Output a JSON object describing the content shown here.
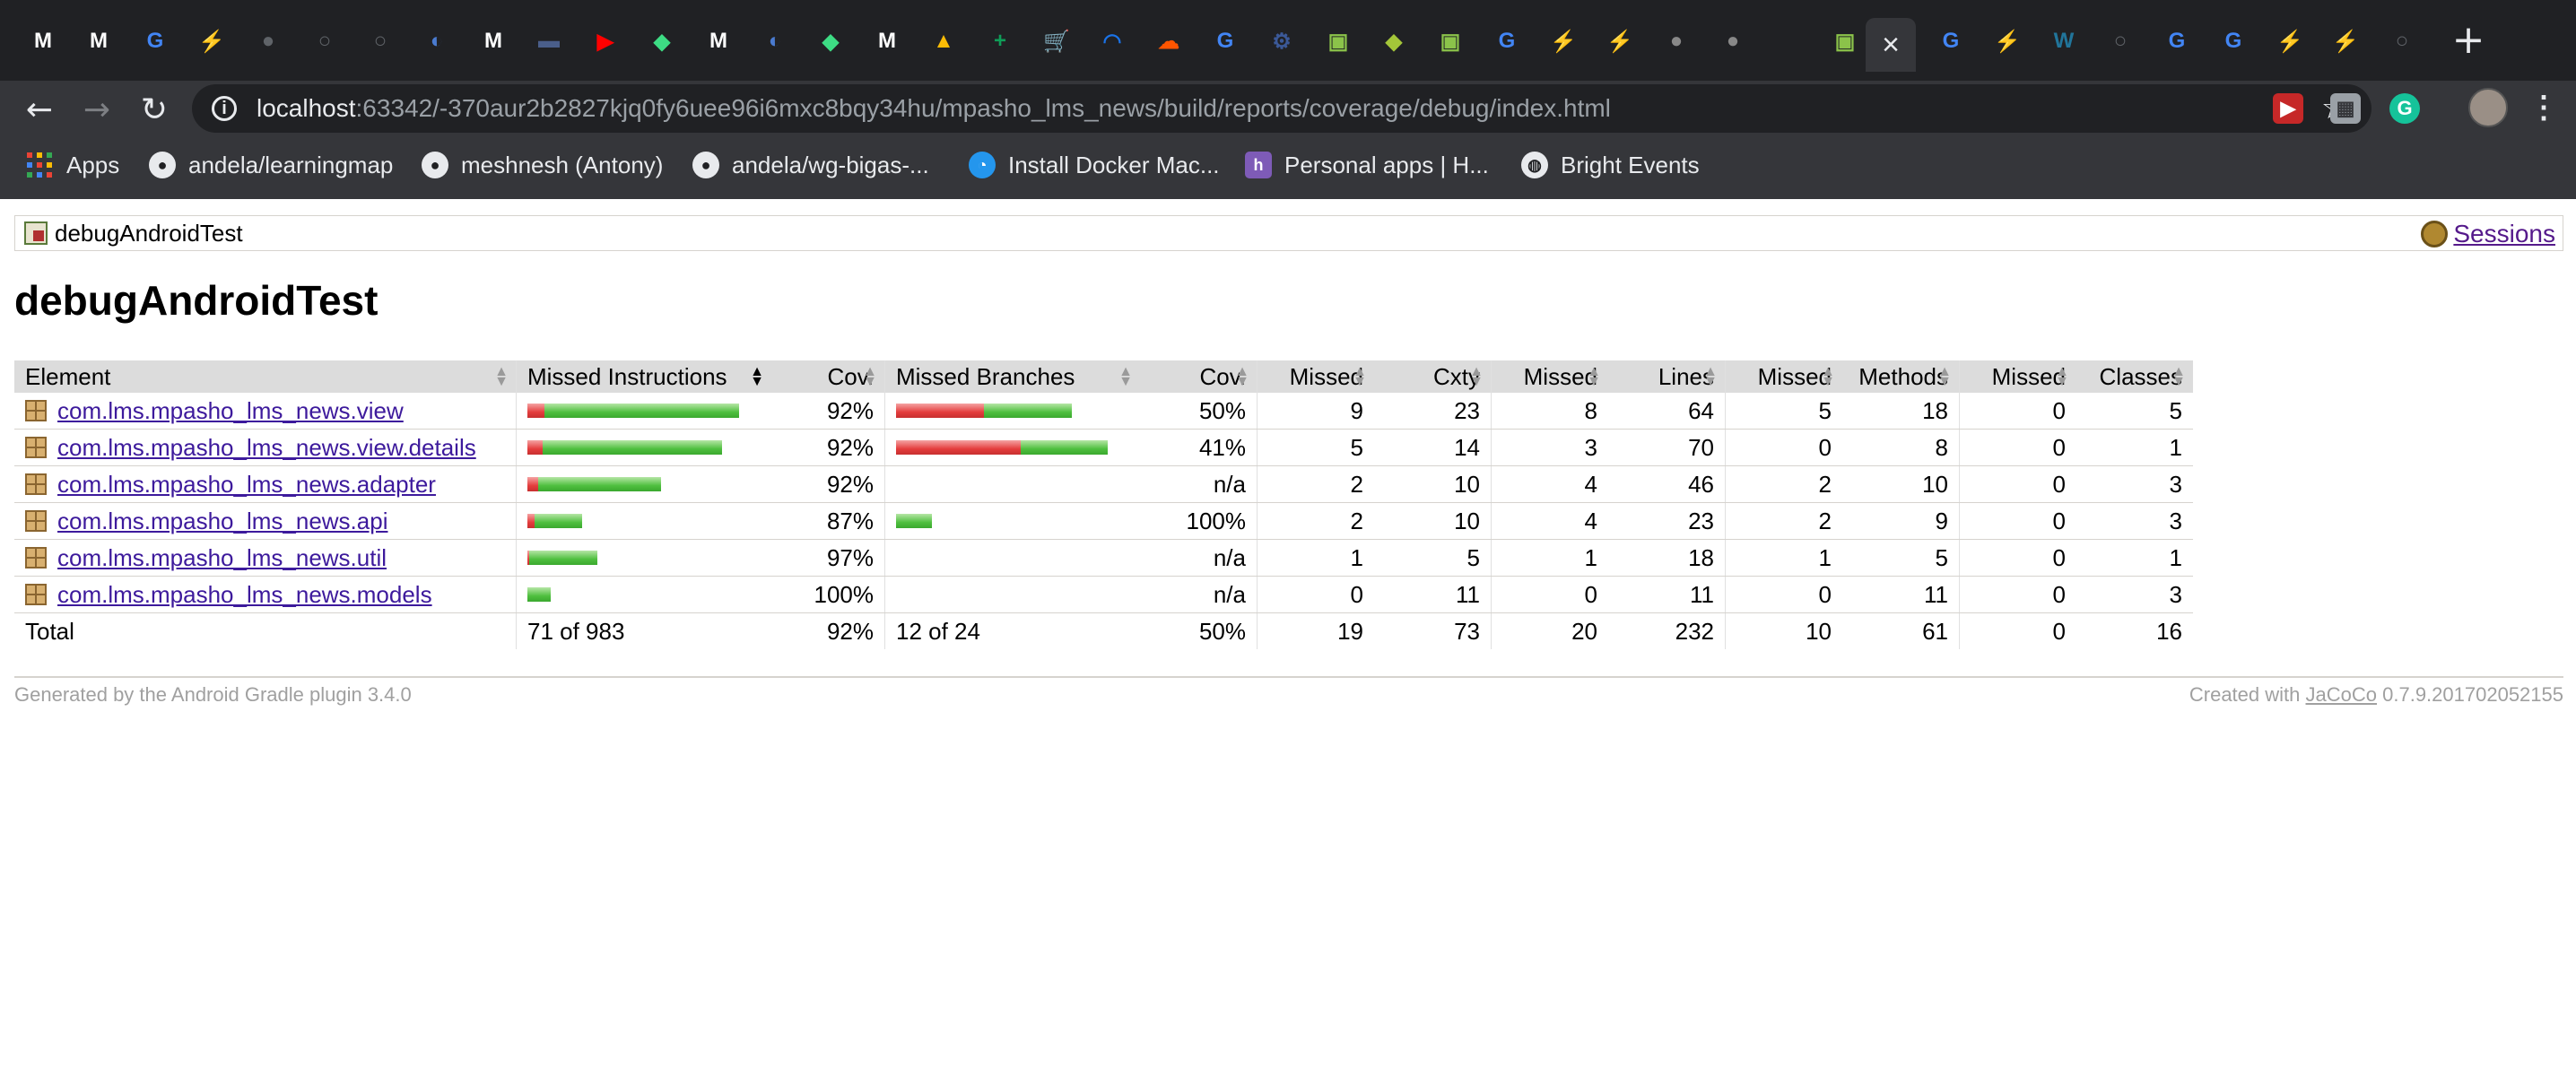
{
  "browser": {
    "url_host": "localhost",
    "url_rest": ":63342/-370aur2b2827kjq0fy6uee96i6mxc8bqy34hu/mpasho_lms_news/build/reports/coverage/debug/index.html",
    "tab_glyphs": [
      "M",
      "M",
      "G",
      "⚡",
      "●",
      "○",
      "○",
      "◐",
      "M",
      "▬",
      "▶",
      "◆",
      "M",
      "◐",
      "◆",
      "M",
      "▲",
      "+",
      "🛒",
      "◠",
      "☁",
      "G",
      "⚙",
      "▣",
      "◆",
      "▣",
      "G",
      "⚡",
      "⚡",
      "●",
      "●",
      "",
      "▣",
      "×",
      "G",
      "⚡",
      "W",
      "○",
      "G",
      "G",
      "⚡",
      "⚡",
      "○"
    ],
    "new_tab": "+"
  },
  "bookmarks": [
    {
      "label": "Apps",
      "icon": "apps-grid-icon"
    },
    {
      "label": "andela/learningmap",
      "icon": "github-icon"
    },
    {
      "label": "meshnesh (Antony)",
      "icon": "github-icon"
    },
    {
      "label": "andela/wg-bigas-...",
      "icon": "github-icon"
    },
    {
      "label": "Install Docker Mac...",
      "icon": "docker-icon"
    },
    {
      "label": "Personal apps | H...",
      "icon": "heroku-icon"
    },
    {
      "label": "Bright Events",
      "icon": "globe-icon"
    }
  ],
  "report": {
    "breadcrumb": "debugAndroidTest",
    "sessions_link": "Sessions",
    "title": "debugAndroidTest",
    "headers": [
      "Element",
      "Missed Instructions",
      "Cov.",
      "Missed Branches",
      "Cov.",
      "Missed",
      "Cxty",
      "Missed",
      "Lines",
      "Missed",
      "Methods",
      "Missed",
      "Classes"
    ],
    "rows": [
      {
        "name": "com.lms.mpasho_lms_news.view",
        "instr_cov": "92%",
        "branch_cov": "50%",
        "cxty_missed": "9",
        "cxty": "23",
        "lines_missed": "8",
        "lines": "64",
        "methods_missed": "5",
        "methods": "18",
        "classes_missed": "0",
        "classes": "5",
        "instr_bar": {
          "missed": 0.08,
          "covered": 0.92,
          "total_fraction": 1.0
        },
        "branch_bar": {
          "missed": 0.5,
          "covered": 0.5,
          "total_fraction": 0.83
        }
      },
      {
        "name": "com.lms.mpasho_lms_news.view.details",
        "instr_cov": "92%",
        "branch_cov": "41%",
        "cxty_missed": "5",
        "cxty": "14",
        "lines_missed": "3",
        "lines": "70",
        "methods_missed": "0",
        "methods": "8",
        "classes_missed": "0",
        "classes": "1",
        "instr_bar": {
          "missed": 0.08,
          "covered": 0.92,
          "total_fraction": 0.92
        },
        "branch_bar": {
          "missed": 0.59,
          "covered": 0.41,
          "total_fraction": 1.0
        }
      },
      {
        "name": "com.lms.mpasho_lms_news.adapter",
        "instr_cov": "92%",
        "branch_cov": "n/a",
        "cxty_missed": "2",
        "cxty": "10",
        "lines_missed": "4",
        "lines": "46",
        "methods_missed": "2",
        "methods": "10",
        "classes_missed": "0",
        "classes": "3",
        "instr_bar": {
          "missed": 0.08,
          "covered": 0.92,
          "total_fraction": 0.63
        },
        "branch_bar": null
      },
      {
        "name": "com.lms.mpasho_lms_news.api",
        "instr_cov": "87%",
        "branch_cov": "100%",
        "cxty_missed": "2",
        "cxty": "10",
        "lines_missed": "4",
        "lines": "23",
        "methods_missed": "2",
        "methods": "9",
        "classes_missed": "0",
        "classes": "3",
        "instr_bar": {
          "missed": 0.13,
          "covered": 0.87,
          "total_fraction": 0.26
        },
        "branch_bar": {
          "missed": 0.0,
          "covered": 1.0,
          "total_fraction": 0.17
        }
      },
      {
        "name": "com.lms.mpasho_lms_news.util",
        "instr_cov": "97%",
        "branch_cov": "n/a",
        "cxty_missed": "1",
        "cxty": "5",
        "lines_missed": "1",
        "lines": "18",
        "methods_missed": "1",
        "methods": "5",
        "classes_missed": "0",
        "classes": "1",
        "instr_bar": {
          "missed": 0.03,
          "covered": 0.97,
          "total_fraction": 0.33
        },
        "branch_bar": null
      },
      {
        "name": "com.lms.mpasho_lms_news.models",
        "instr_cov": "100%",
        "branch_cov": "n/a",
        "cxty_missed": "0",
        "cxty": "11",
        "lines_missed": "0",
        "lines": "11",
        "methods_missed": "0",
        "methods": "11",
        "classes_missed": "0",
        "classes": "3",
        "instr_bar": {
          "missed": 0.0,
          "covered": 1.0,
          "total_fraction": 0.11
        },
        "branch_bar": null
      }
    ],
    "total": {
      "label": "Total",
      "instr": "71 of 983",
      "instr_cov": "92%",
      "branch": "12 of 24",
      "branch_cov": "50%",
      "cxty_missed": "19",
      "cxty": "73",
      "lines_missed": "20",
      "lines": "232",
      "methods_missed": "10",
      "methods": "61",
      "classes_missed": "0",
      "classes": "16"
    },
    "footer_left": "Generated by the Android Gradle plugin 3.4.0",
    "footer_created": "Created with",
    "footer_link": "JaCoCo",
    "footer_version": "0.7.9.201702052155"
  },
  "colors": {
    "missed": "#e43d3d",
    "covered": "#4fbf3f",
    "link": "#3d1a9c",
    "visited": "#551a8b"
  }
}
